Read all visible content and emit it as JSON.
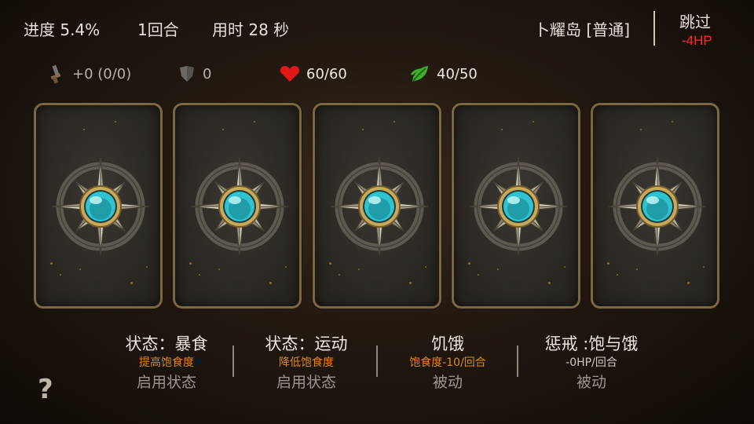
{
  "header": {
    "progress": "进度 5.4%",
    "round": "1回合",
    "time": "用时 28 秒",
    "location": "卜耀岛 [普通]",
    "skip_label": "跳过",
    "skip_cost": "-4HP"
  },
  "stats": {
    "attack": "+0 (0/0)",
    "armor": "0",
    "hp": "60/60",
    "food": "40/50"
  },
  "cards": [
    {
      "icon": "compass-star-gem-icon"
    },
    {
      "icon": "compass-star-gem-icon"
    },
    {
      "icon": "compass-star-gem-icon"
    },
    {
      "icon": "compass-star-gem-icon"
    },
    {
      "icon": "compass-star-gem-icon"
    }
  ],
  "statuses": [
    {
      "title": "状态：暴食",
      "desc": "提高饱食度",
      "action": "启用状态"
    },
    {
      "title": "状态：运动",
      "desc": "降低饱食度",
      "action": "启用状态"
    },
    {
      "title": "饥饿",
      "desc": "饱食度-10/回合",
      "action": "被动"
    },
    {
      "title": "惩戒 :饱与饿",
      "desc": "-0HP/回合",
      "action": "被动"
    }
  ],
  "help": "?",
  "colors": {
    "accent_orange": "#d98a1e",
    "danger_red": "#ff2a20",
    "card_border": "#7b6843",
    "gem_cyan": "#2fc3cf"
  }
}
